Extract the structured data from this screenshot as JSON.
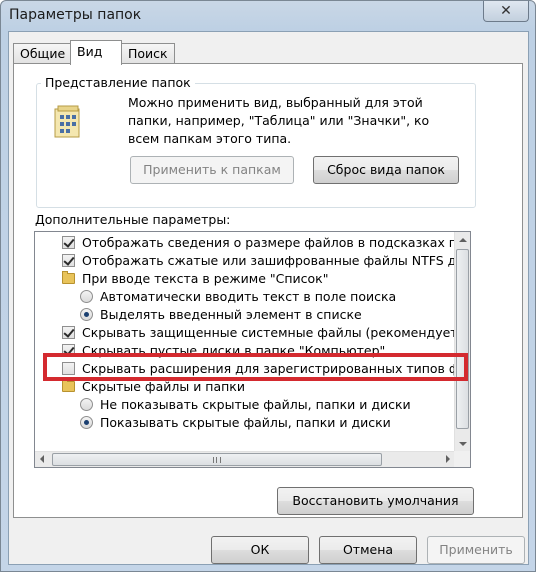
{
  "window": {
    "title": "Параметры папок"
  },
  "tabs": [
    {
      "label": "Общие"
    },
    {
      "label": "Вид"
    },
    {
      "label": "Поиск"
    }
  ],
  "folder_views": {
    "title": "Представление папок",
    "description": "Можно применить вид, выбранный для этой папки, например, \"Таблица\" или \"Значки\", ко всем папкам этого типа.",
    "apply_button": "Применить к папкам",
    "reset_button": "Сброс вида папок"
  },
  "advanced": {
    "label": "Дополнительные параметры:",
    "items": [
      {
        "type": "checkbox",
        "checked": true,
        "label": "Отображать сведения о размере файлов в подсказках па"
      },
      {
        "type": "checkbox",
        "checked": true,
        "label": "Отображать сжатые или зашифрованные файлы NTFS др"
      },
      {
        "type": "folder",
        "label": "При вводе текста в режиме \"Список\""
      },
      {
        "type": "radio",
        "checked": false,
        "label": "Автоматически вводить текст в поле поиска"
      },
      {
        "type": "radio",
        "checked": true,
        "label": "Выделять введенный элемент в списке"
      },
      {
        "type": "checkbox",
        "checked": true,
        "label": "Скрывать защищенные системные файлы (рекомендуется"
      },
      {
        "type": "checkbox",
        "checked": true,
        "label": "Скрывать пустые диски в папке \"Компьютер\""
      },
      {
        "type": "checkbox",
        "checked": false,
        "label": "Скрывать расширения для зарегистрированных типов фа"
      },
      {
        "type": "folder",
        "label": "Скрытые файлы и папки"
      },
      {
        "type": "radio",
        "checked": false,
        "label": "Не показывать скрытые файлы, папки и диски"
      },
      {
        "type": "radio",
        "checked": true,
        "label": "Показывать скрытые файлы, папки и диски"
      }
    ],
    "restore_button": "Восстановить умолчания"
  },
  "footer": {
    "ok": "ОК",
    "cancel": "Отмена",
    "apply": "Применить"
  },
  "colors": {
    "highlight": "#d42a2f",
    "title_bar": "#c4d5e8"
  },
  "icons": [
    "close-icon",
    "folder-view-icon",
    "folder-icon",
    "checkbox",
    "radio-button"
  ]
}
